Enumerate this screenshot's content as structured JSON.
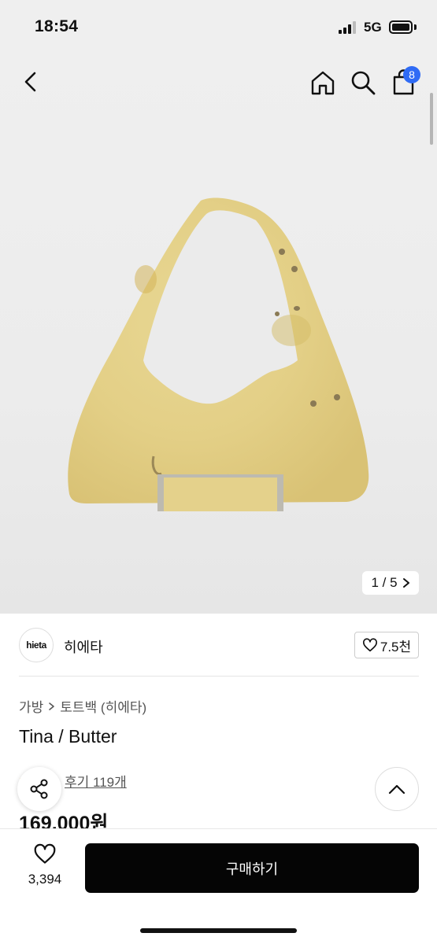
{
  "status_bar": {
    "time": "18:54",
    "network": "5G"
  },
  "header": {
    "cart_count": "8",
    "icons": [
      "back-icon",
      "home-icon",
      "search-icon",
      "cart-icon"
    ]
  },
  "gallery": {
    "pager": "1 / 5",
    "logo_text": "hieta"
  },
  "brand": {
    "logo_text": "hieta",
    "name": "히에타",
    "likes": "7.5천"
  },
  "breadcrumb": {
    "category": "가방",
    "subcategory": "토트백 (히에타)"
  },
  "product": {
    "name": "Tina / Butter",
    "reviews": "후기 119개",
    "price": "169,000원"
  },
  "bottom": {
    "wish_count": "3,394",
    "buy_label": "구매하기"
  },
  "colors": {
    "background": "#efefef",
    "badge": "#2f6bf5",
    "buy_button": "#050505",
    "bag": "#e3d08a"
  }
}
